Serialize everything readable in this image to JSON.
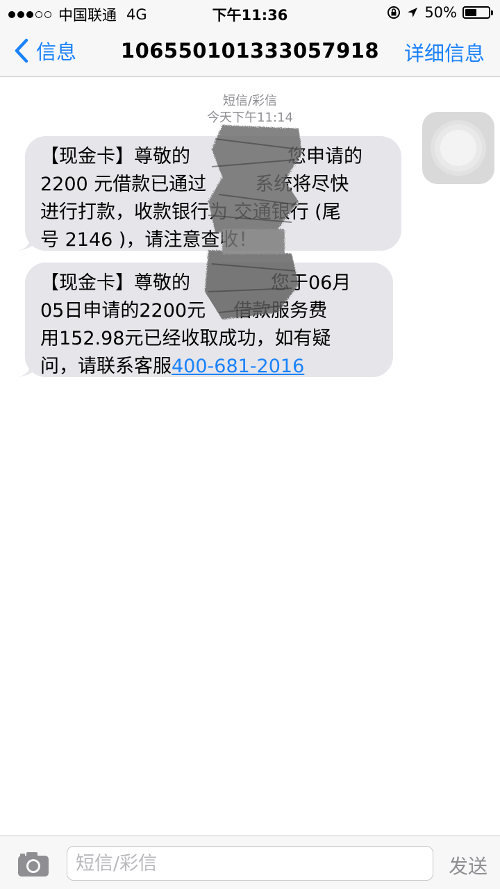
{
  "status_bar": {
    "carrier": "中国联通",
    "network": "4G",
    "time": "下午11:36",
    "battery": "50%",
    "battery_level": 0.5
  },
  "nav": {
    "back_label": "信息",
    "title": "10655010133305791​8",
    "details_label": "详细信息"
  },
  "thread": {
    "type_label": "短信/彩信",
    "timestamp": "今天下午11:14"
  },
  "messages": [
    {
      "lines": [
        "【现金卡】尊敬的",
        "您申请的",
        "2200 元借款已通过",
        "系统将尽快",
        "进行打款，收款银行为 交通银行 (尾",
        "号 2146 )，请注意查收！"
      ]
    },
    {
      "lines": [
        "【现金卡】尊敬的",
        "您于06月",
        "05日申请的2200元",
        "借款服务费",
        "用152.98元已经收取成功，如有疑",
        "问，请联系客服"
      ],
      "phone": "400-681-2016"
    }
  ],
  "input": {
    "placeholder": "短信/彩信",
    "send_label": "发送"
  },
  "icons": {
    "back": "chevron-left-icon",
    "camera": "camera-icon",
    "location": "location-arrow-icon",
    "rotation_lock": "rotation-lock-icon",
    "assistive_touch": "assistive-touch-icon"
  },
  "colors": {
    "accent": "#1a82fb",
    "bubble": "#e5e5ea",
    "meta_text": "#8e8e93"
  }
}
